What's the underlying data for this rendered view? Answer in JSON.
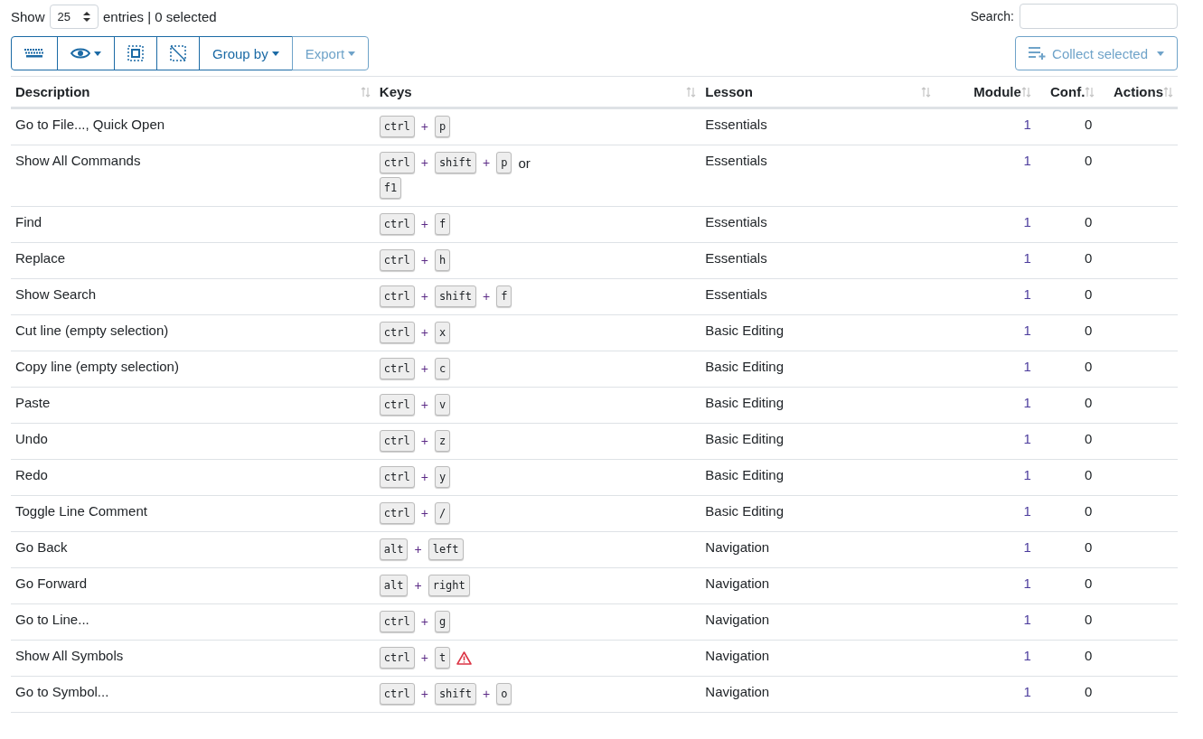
{
  "length_menu": {
    "label_before": "Show",
    "value": "25",
    "label_after": "entries | 0 selected"
  },
  "search": {
    "label": "Search:"
  },
  "toolbar": [
    {
      "kind": "keyboard",
      "disabled": false
    },
    {
      "kind": "eye",
      "disabled": false
    },
    {
      "kind": "select-all",
      "disabled": false
    },
    {
      "kind": "deselect",
      "disabled": false
    },
    {
      "kind": "text",
      "label": "Group by",
      "disabled": false
    },
    {
      "kind": "text",
      "label": "Export",
      "disabled": true
    }
  ],
  "collect_button": {
    "label": "Collect selected",
    "disabled": true
  },
  "table": {
    "columns": [
      "Description",
      "Keys",
      "Lesson",
      "Module",
      "Conf.",
      "Actions"
    ],
    "rows": [
      {
        "description": "Go to File..., Quick Open",
        "keys": [
          [
            {
              "kind": "key",
              "text": "ctrl"
            },
            {
              "kind": "plus",
              "text": "+"
            },
            {
              "kind": "key",
              "text": "p"
            }
          ]
        ],
        "lesson": "Essentials",
        "module": "1",
        "conf": "0"
      },
      {
        "description": "Show All Commands",
        "keys": [
          [
            {
              "kind": "key",
              "text": "ctrl"
            },
            {
              "kind": "plus",
              "text": "+"
            },
            {
              "kind": "key",
              "text": "shift"
            },
            {
              "kind": "plus",
              "text": "+"
            },
            {
              "kind": "key",
              "text": "p"
            },
            {
              "kind": "or",
              "text": "or"
            }
          ],
          [
            {
              "kind": "key",
              "text": "f1"
            }
          ]
        ],
        "lesson": "Essentials",
        "module": "1",
        "conf": "0"
      },
      {
        "description": "Find",
        "keys": [
          [
            {
              "kind": "key",
              "text": "ctrl"
            },
            {
              "kind": "plus",
              "text": "+"
            },
            {
              "kind": "key",
              "text": "f"
            }
          ]
        ],
        "lesson": "Essentials",
        "module": "1",
        "conf": "0"
      },
      {
        "description": "Replace",
        "keys": [
          [
            {
              "kind": "key",
              "text": "ctrl"
            },
            {
              "kind": "plus",
              "text": "+"
            },
            {
              "kind": "key",
              "text": "h"
            }
          ]
        ],
        "lesson": "Essentials",
        "module": "1",
        "conf": "0"
      },
      {
        "description": "Show Search",
        "keys": [
          [
            {
              "kind": "key",
              "text": "ctrl"
            },
            {
              "kind": "plus",
              "text": "+"
            },
            {
              "kind": "key",
              "text": "shift"
            },
            {
              "kind": "plus",
              "text": "+"
            },
            {
              "kind": "key",
              "text": "f"
            }
          ]
        ],
        "lesson": "Essentials",
        "module": "1",
        "conf": "0"
      },
      {
        "description": "Cut line (empty selection)",
        "keys": [
          [
            {
              "kind": "key",
              "text": "ctrl"
            },
            {
              "kind": "plus",
              "text": "+"
            },
            {
              "kind": "key",
              "text": "x"
            }
          ]
        ],
        "lesson": "Basic Editing",
        "module": "1",
        "conf": "0"
      },
      {
        "description": "Copy line (empty selection)",
        "keys": [
          [
            {
              "kind": "key",
              "text": "ctrl"
            },
            {
              "kind": "plus",
              "text": "+"
            },
            {
              "kind": "key",
              "text": "c"
            }
          ]
        ],
        "lesson": "Basic Editing",
        "module": "1",
        "conf": "0"
      },
      {
        "description": "Paste",
        "keys": [
          [
            {
              "kind": "key",
              "text": "ctrl"
            },
            {
              "kind": "plus",
              "text": "+"
            },
            {
              "kind": "key",
              "text": "v"
            }
          ]
        ],
        "lesson": "Basic Editing",
        "module": "1",
        "conf": "0"
      },
      {
        "description": "Undo",
        "keys": [
          [
            {
              "kind": "key",
              "text": "ctrl"
            },
            {
              "kind": "plus",
              "text": "+"
            },
            {
              "kind": "key",
              "text": "z"
            }
          ]
        ],
        "lesson": "Basic Editing",
        "module": "1",
        "conf": "0"
      },
      {
        "description": "Redo",
        "keys": [
          [
            {
              "kind": "key",
              "text": "ctrl"
            },
            {
              "kind": "plus",
              "text": "+"
            },
            {
              "kind": "key",
              "text": "y"
            }
          ]
        ],
        "lesson": "Basic Editing",
        "module": "1",
        "conf": "0"
      },
      {
        "description": "Toggle Line Comment",
        "keys": [
          [
            {
              "kind": "key",
              "text": "ctrl"
            },
            {
              "kind": "plus",
              "text": "+"
            },
            {
              "kind": "key",
              "text": "/"
            }
          ]
        ],
        "lesson": "Basic Editing",
        "module": "1",
        "conf": "0"
      },
      {
        "description": "Go Back",
        "keys": [
          [
            {
              "kind": "key",
              "text": "alt"
            },
            {
              "kind": "plus",
              "text": "+"
            },
            {
              "kind": "key",
              "text": "left"
            }
          ]
        ],
        "lesson": "Navigation",
        "module": "1",
        "conf": "0"
      },
      {
        "description": "Go Forward",
        "keys": [
          [
            {
              "kind": "key",
              "text": "alt"
            },
            {
              "kind": "plus",
              "text": "+"
            },
            {
              "kind": "key",
              "text": "right"
            }
          ]
        ],
        "lesson": "Navigation",
        "module": "1",
        "conf": "0"
      },
      {
        "description": "Go to Line...",
        "keys": [
          [
            {
              "kind": "key",
              "text": "ctrl"
            },
            {
              "kind": "plus",
              "text": "+"
            },
            {
              "kind": "key",
              "text": "g"
            }
          ]
        ],
        "lesson": "Navigation",
        "module": "1",
        "conf": "0"
      },
      {
        "description": "Show All Symbols",
        "keys": [
          [
            {
              "kind": "key",
              "text": "ctrl"
            },
            {
              "kind": "plus",
              "text": "+"
            },
            {
              "kind": "key",
              "text": "t"
            },
            {
              "kind": "warning"
            }
          ]
        ],
        "lesson": "Navigation",
        "module": "1",
        "conf": "0"
      },
      {
        "description": "Go to Symbol...",
        "keys": [
          [
            {
              "kind": "key",
              "text": "ctrl"
            },
            {
              "kind": "plus",
              "text": "+"
            },
            {
              "kind": "key",
              "text": "shift"
            },
            {
              "kind": "plus",
              "text": "+"
            },
            {
              "kind": "key",
              "text": "o"
            }
          ]
        ],
        "lesson": "Navigation",
        "module": "1",
        "conf": "0"
      }
    ]
  }
}
